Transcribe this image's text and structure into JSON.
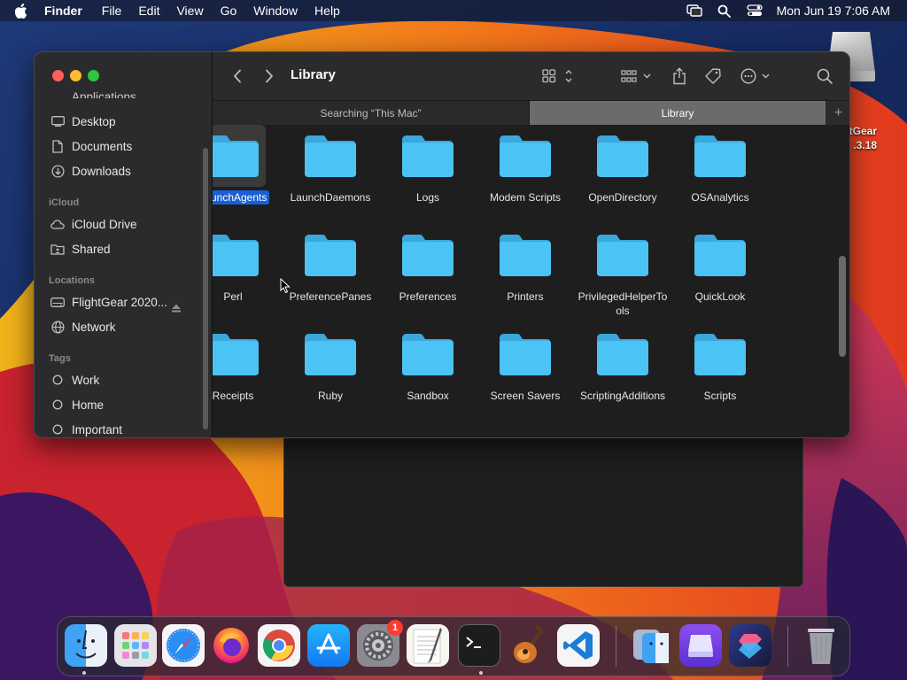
{
  "menubar": {
    "app_name": "Finder",
    "menus": [
      "File",
      "Edit",
      "View",
      "Go",
      "Window",
      "Help"
    ],
    "clock": "Mon Jun 19  7:06 AM",
    "status_icons": [
      "screen-mirroring-icon",
      "spotlight-search-icon",
      "control-center-icon"
    ]
  },
  "desktop": {
    "drive_label_line1": "tGear",
    "drive_label_line2": ".3.18"
  },
  "finder": {
    "title": "Library",
    "sidebar": {
      "partial_item": "Applications",
      "favorites": [
        {
          "label": "Desktop",
          "icon": "desktop-icon"
        },
        {
          "label": "Documents",
          "icon": "document-icon"
        },
        {
          "label": "Downloads",
          "icon": "downloads-icon"
        }
      ],
      "icloud_heading": "iCloud",
      "icloud": [
        {
          "label": "iCloud Drive",
          "icon": "cloud-icon"
        },
        {
          "label": "Shared",
          "icon": "shared-folder-icon"
        }
      ],
      "locations_heading": "Locations",
      "locations": [
        {
          "label": "FlightGear 2020...",
          "icon": "disk-icon"
        },
        {
          "label": "Network",
          "icon": "network-icon"
        }
      ],
      "tags_heading": "Tags",
      "tags": [
        {
          "label": "Work"
        },
        {
          "label": "Home"
        },
        {
          "label": "Important"
        }
      ]
    },
    "tabs": [
      {
        "label": "Searching “This Mac”",
        "active": false
      },
      {
        "label": "Library",
        "active": true
      }
    ],
    "tab_add": "+",
    "folders": [
      {
        "name": "LaunchAgents",
        "selected": true
      },
      {
        "name": "LaunchDaemons"
      },
      {
        "name": "Logs"
      },
      {
        "name": "Modem Scripts"
      },
      {
        "name": "OpenDirectory"
      },
      {
        "name": "OSAnalytics"
      },
      {
        "name": "Perl"
      },
      {
        "name": "PreferencePanes"
      },
      {
        "name": "Preferences"
      },
      {
        "name": "Printers"
      },
      {
        "name": "PrivilegedHelperTools"
      },
      {
        "name": "QuickLook"
      },
      {
        "name": "Receipts"
      },
      {
        "name": "Ruby"
      },
      {
        "name": "Sandbox"
      },
      {
        "name": "Screen Savers"
      },
      {
        "name": "ScriptingAdditions"
      },
      {
        "name": "Scripts"
      }
    ]
  },
  "dock": {
    "apps": [
      {
        "name": "Finder",
        "icon": "finder-icon",
        "running": true
      },
      {
        "name": "Launchpad",
        "icon": "launchpad-icon"
      },
      {
        "name": "Safari",
        "icon": "safari-icon"
      },
      {
        "name": "Firefox",
        "icon": "firefox-icon"
      },
      {
        "name": "Chrome",
        "icon": "chrome-icon"
      },
      {
        "name": "App Store",
        "icon": "app-store-icon"
      },
      {
        "name": "System Preferences",
        "icon": "system-preferences-icon",
        "badge": "1"
      },
      {
        "name": "TextEdit",
        "icon": "textedit-icon"
      },
      {
        "name": "Terminal",
        "icon": "terminal-icon",
        "running": true
      },
      {
        "name": "GarageBand",
        "icon": "garageband-icon"
      },
      {
        "name": "Visual Studio Code",
        "icon": "vscode-icon"
      },
      {
        "name": "Migration Assistant",
        "icon": "migration-assistant-icon"
      },
      {
        "name": "Drive",
        "icon": "drive-icon"
      },
      {
        "name": "Shortcuts",
        "icon": "shortcuts-icon"
      },
      {
        "name": "Trash",
        "icon": "trash-icon"
      }
    ]
  },
  "colors": {
    "selection": "#1a5fd4",
    "folder": "#4cc3f5",
    "close": "#ff5f57",
    "minimize": "#febc2e",
    "maximize": "#28c840"
  }
}
